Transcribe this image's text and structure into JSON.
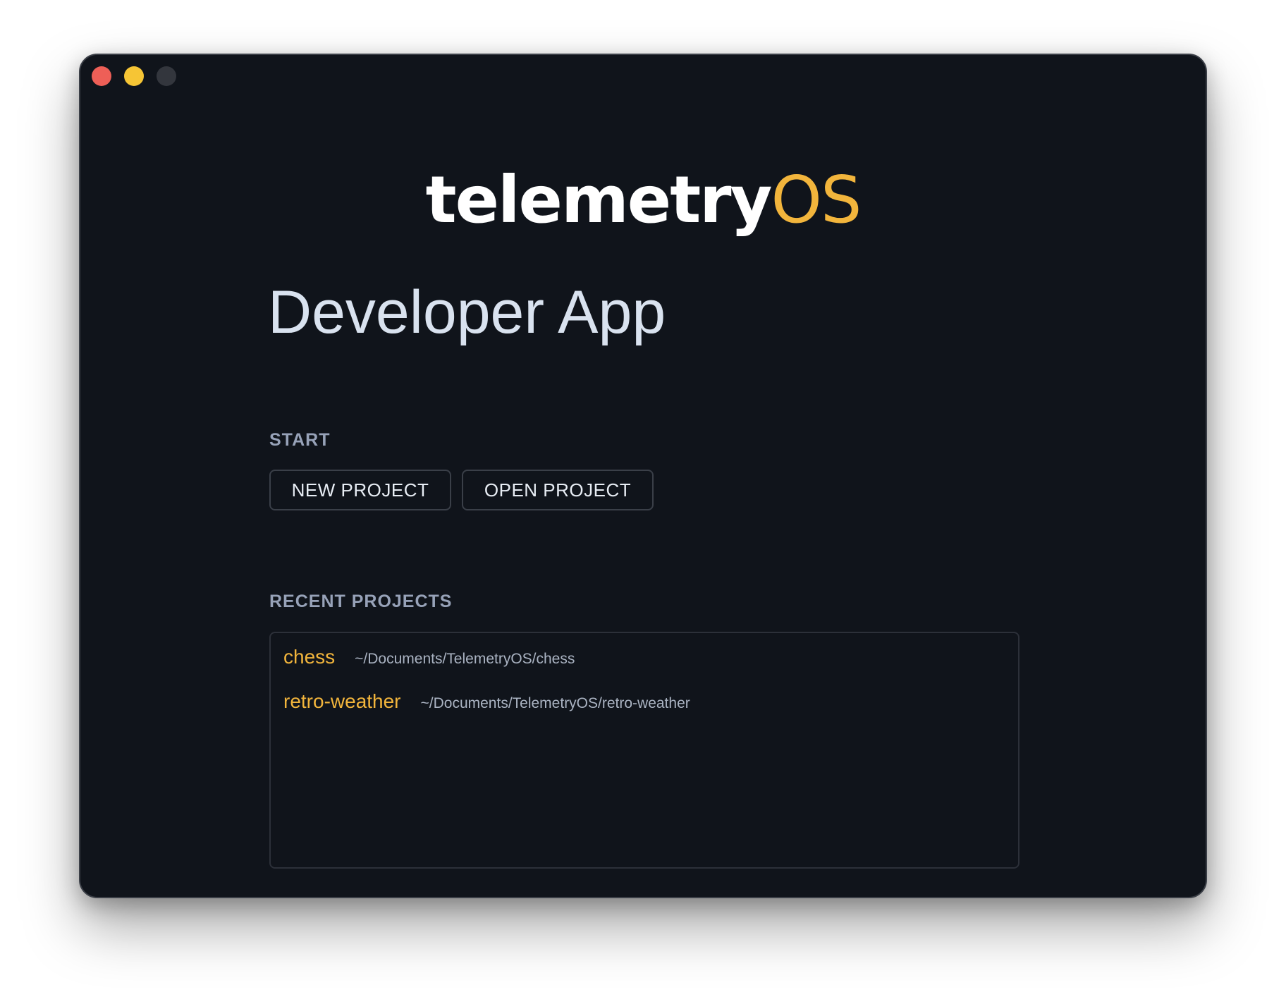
{
  "window": {
    "controls": [
      {
        "name": "close-button",
        "color": "#ee5f57"
      },
      {
        "name": "minimize-button",
        "color": "#f6c535"
      },
      {
        "name": "maximize-button",
        "color": "#33363d"
      }
    ]
  },
  "logo": {
    "part_a": "telemetry",
    "part_b": "OS",
    "color_a": "#ffffff",
    "color_b": "#f2b53c"
  },
  "title": "Developer App",
  "start": {
    "heading": "START",
    "new_project_label": "NEW PROJECT",
    "open_project_label": "OPEN PROJECT"
  },
  "recent": {
    "heading": "RECENT PROJECTS",
    "items": [
      {
        "name": "chess",
        "path": "~/Documents/TelemetryOS/chess"
      },
      {
        "name": "retro-weather",
        "path": "~/Documents/TelemetryOS/retro-weather"
      }
    ]
  },
  "colors": {
    "accent": "#f2b53c",
    "background": "#10141b"
  }
}
